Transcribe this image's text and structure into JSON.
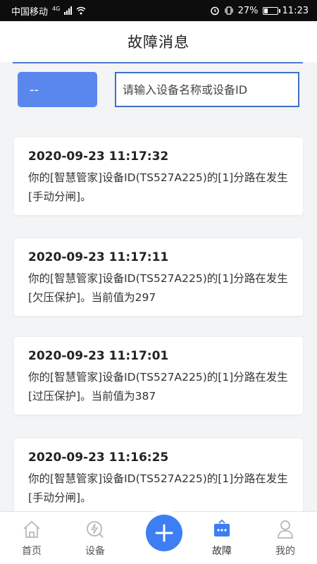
{
  "status_bar": {
    "carrier": "中国移动",
    "network": "4G",
    "battery": "27%",
    "time": "11:23"
  },
  "header": {
    "title": "故障消息"
  },
  "filter": {
    "device_select": "--",
    "search_placeholder": "请输入设备名称或设备ID"
  },
  "messages": [
    {
      "time": "2020-09-23 11:17:32",
      "text": "你的[智慧管家]设备ID(TS527A225)的[1]分路在发生[手动分闸]。"
    },
    {
      "time": "2020-09-23 11:17:11",
      "text": "你的[智慧管家]设备ID(TS527A225)的[1]分路在发生[欠压保护]。当前值为297"
    },
    {
      "time": "2020-09-23 11:17:01",
      "text": "你的[智慧管家]设备ID(TS527A225)的[1]分路在发生[过压保护]。当前值为387"
    },
    {
      "time": "2020-09-23 11:16:25",
      "text": "你的[智慧管家]设备ID(TS527A225)的[1]分路在发生[手动分闸]。"
    }
  ],
  "nav": {
    "home": "首页",
    "device": "设备",
    "fault": "故障",
    "mine": "我的"
  },
  "colors": {
    "accent": "#5a87ee",
    "fab": "#3d7ef2",
    "active_nav": "#3d7ef2"
  }
}
